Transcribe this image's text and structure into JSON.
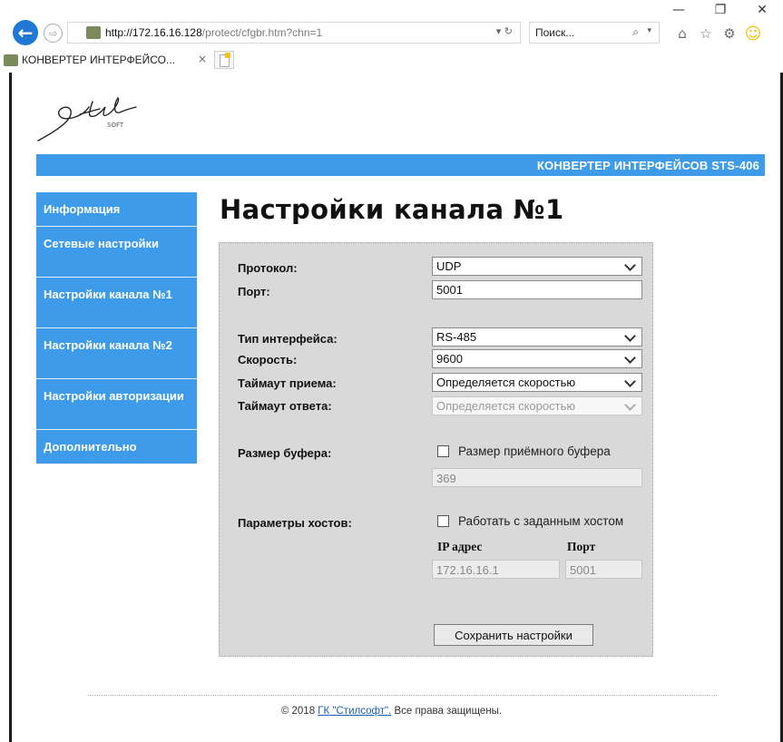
{
  "browser": {
    "window_controls": {
      "minimize": "—",
      "restore": "❐",
      "close": "✕"
    },
    "url_host": "http://172.16.16.128",
    "url_path": "/protect/cfgbr.htm?chn=1",
    "addr_actions": "▾ ↻",
    "search_placeholder": "Поиск...",
    "tab_title": "КОНВЕРТЕР ИНТЕРФЕЙСО...",
    "tab_close": "×",
    "back_glyph": "←",
    "forward_glyph": "⇨",
    "icons": [
      "home-icon",
      "star-icon",
      "gear-icon",
      "smiley-icon"
    ]
  },
  "header": {
    "banner": "КОНВЕРТЕР ИНТЕРФЕЙСОВ STS-406"
  },
  "sidebar": {
    "items": [
      {
        "label": "Информация"
      },
      {
        "label": "Сетевые настройки"
      },
      {
        "label": "Настройки канала №1"
      },
      {
        "label": "Настройки канала №2"
      },
      {
        "label": "Настройки авторизации"
      },
      {
        "label": "Дополнительно"
      }
    ]
  },
  "main": {
    "title": "Настройки канала №1",
    "form": {
      "protocol_label": "Протокол:",
      "protocol_value": "UDP",
      "port_label": "Порт:",
      "port_value": "5001",
      "iface_label": "Тип интерфейса:",
      "iface_value": "RS-485",
      "speed_label": "Скорость:",
      "speed_value": "9600",
      "rx_timeout_label": "Таймаут приема:",
      "rx_timeout_value": "Определяется скоростью",
      "resp_timeout_label": "Таймаут ответа:",
      "resp_timeout_value": "Определяется скоростью",
      "buffer_label": "Размер буфера:",
      "buffer_checkbox_label": "Размер приёмного буфера",
      "buffer_value": "369",
      "hosts_label": "Параметры хостов:",
      "hosts_checkbox_label": "Работать с заданным хостом",
      "ip_header": "IP адрес",
      "port_header": "Порт",
      "host_ip_value": "172.16.16.1",
      "host_port_value": "5001",
      "save_label": "Сохранить настройки"
    }
  },
  "footer": {
    "prefix": "© 2018 ",
    "link": "ГК \"Стилсофт\".",
    "suffix": " Все права защищены."
  },
  "colors": {
    "accent": "#3d9bea",
    "panel": "#d9d9d9",
    "link": "#1a5fb4"
  }
}
